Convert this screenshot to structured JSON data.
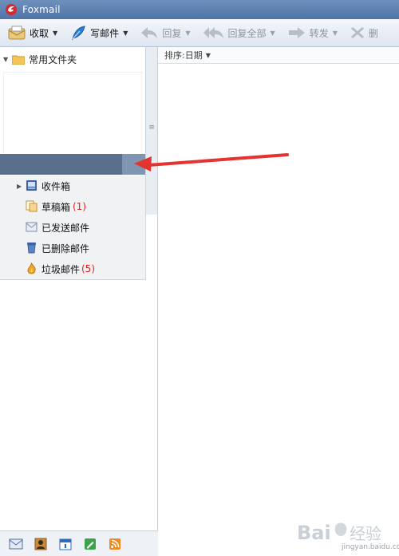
{
  "window": {
    "title": "Foxmail"
  },
  "toolbar": {
    "buttons": [
      {
        "label": "收取",
        "icon": "inbox-envelope-icon",
        "dropdown": true,
        "enabled": true
      },
      {
        "label": "写邮件",
        "icon": "feather-pen-icon",
        "dropdown": true,
        "enabled": true
      },
      {
        "label": "回复",
        "icon": "reply-arrow-icon",
        "dropdown": true,
        "enabled": false
      },
      {
        "label": "回复全部",
        "icon": "reply-all-icon",
        "dropdown": true,
        "enabled": false
      },
      {
        "label": "转发",
        "icon": "forward-arrow-icon",
        "dropdown": true,
        "enabled": false
      },
      {
        "label": "删",
        "icon": "delete-icon",
        "dropdown": false,
        "enabled": false
      }
    ]
  },
  "sidebar": {
    "section": {
      "label": "常用文件夹",
      "expanded": true
    },
    "folders": [
      {
        "label": "收件箱",
        "icon": "inbox-icon",
        "expandable": true,
        "count": ""
      },
      {
        "label": "草稿箱",
        "icon": "drafts-icon",
        "expandable": false,
        "count": "(1)"
      },
      {
        "label": "已发送邮件",
        "icon": "sent-icon",
        "expandable": false,
        "count": ""
      },
      {
        "label": "已删除邮件",
        "icon": "trash-icon",
        "expandable": false,
        "count": ""
      },
      {
        "label": "垃圾邮件",
        "icon": "junk-icon",
        "expandable": false,
        "count": "(5)"
      }
    ]
  },
  "message_list": {
    "sort_label": "排序:日期"
  },
  "bottom_nav": [
    {
      "icon": "mail-icon"
    },
    {
      "icon": "contacts-icon"
    },
    {
      "icon": "calendar-icon"
    },
    {
      "icon": "notes-icon"
    },
    {
      "icon": "rss-icon"
    }
  ],
  "watermark": {
    "text": "Bai 经验",
    "sub": "jingyan.baidu.com"
  },
  "colors": {
    "accent_red": "#e02020",
    "titlebar": "#5b7fb1",
    "menu_highlight": "#5a6f8c"
  }
}
